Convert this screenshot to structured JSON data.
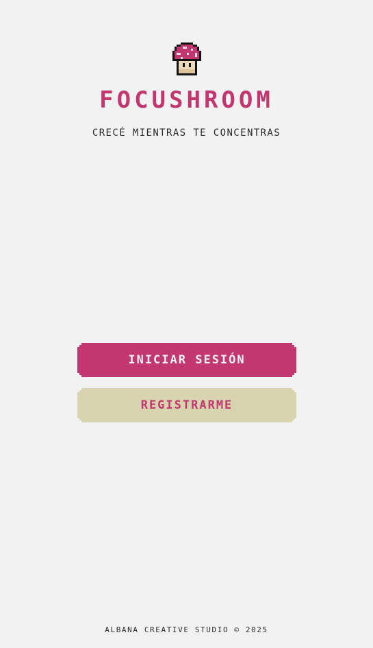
{
  "app": {
    "logo_icon": "pixel-mushroom-icon",
    "title": "FOCUSHROOM",
    "subtitle": "CRECÉ MIENTRAS TE CONCENTRAS"
  },
  "actions": {
    "login_label": "INICIAR SESIÓN",
    "register_label": "REGISTRARME"
  },
  "footer": {
    "text": "ALBANA CREATIVE STUDIO © 2025"
  },
  "colors": {
    "background": "#f2f2f2",
    "accent": "#c2376f",
    "secondary": "#d9d4b0",
    "text": "#2b2b2b"
  }
}
